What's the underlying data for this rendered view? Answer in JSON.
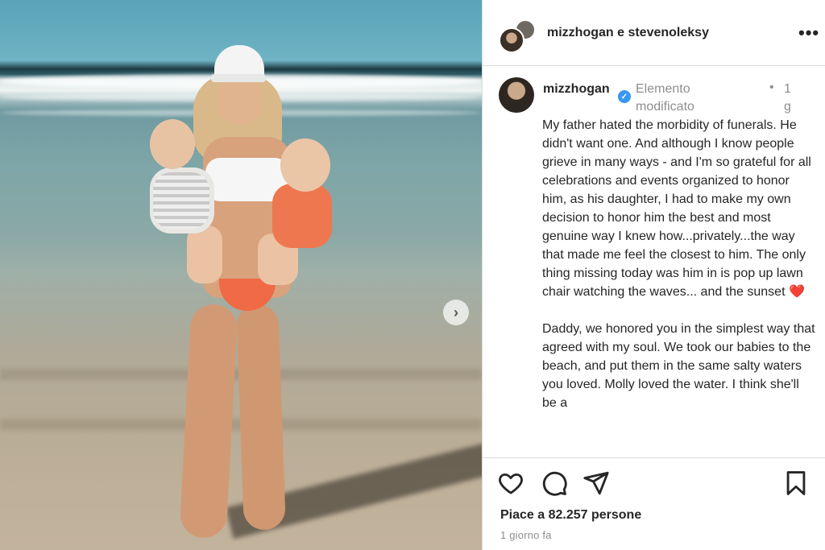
{
  "post": {
    "header_title": "mizzhogan e stevenoleksy",
    "more_icon": "more-dots-icon",
    "caption_user": "mizzhogan",
    "edited_label": "Elemento modificato",
    "time_dot": "•",
    "time_label": "1 g",
    "caption_part1": "My father hated the morbidity of funerals. He didn't want one. And although I know people grieve in many ways - and I'm so grateful for all celebrations and events organized to honor him, as his daughter, I had to make my own decision to honor him the best and most genuine way I knew how...privately...the way that made me feel the closest to him. The only thing missing today was him in is pop up lawn chair watching the waves... and the sunset ",
    "caption_heart": "❤️",
    "caption_part2": "\n\nDaddy, we honored you in the simplest way that agreed with my soul. We took our babies to the beach, and put them in the same salty waters you loved. Molly loved the water. I think she'll be a",
    "likes_label": "Piace a 82.257 persone",
    "posted_ago": "1 giorno fa"
  },
  "icons": {
    "like": "heart-icon",
    "comment": "comment-icon",
    "share": "send-icon",
    "save": "bookmark-icon",
    "next": "chevron-right-icon",
    "verified": "verified-badge-icon"
  },
  "colors": {
    "verified": "#3897f0",
    "muted_text": "#8e8e8e",
    "text": "#262626",
    "divider": "#dbdbdb"
  }
}
